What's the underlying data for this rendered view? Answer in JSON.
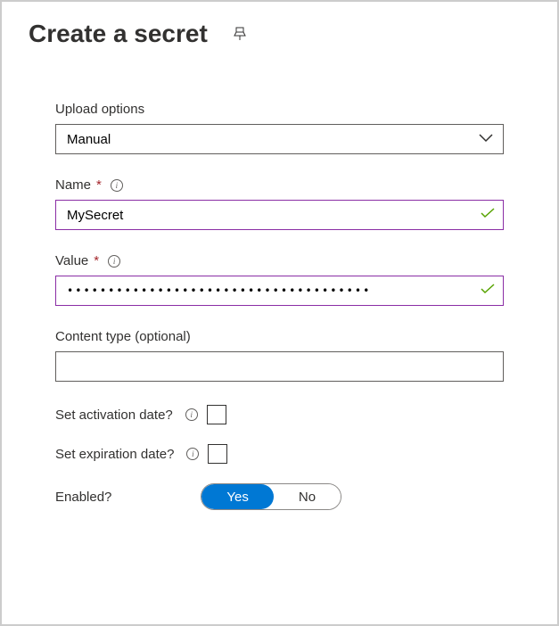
{
  "header": {
    "title": "Create a secret"
  },
  "form": {
    "upload_options": {
      "label": "Upload options",
      "value": "Manual"
    },
    "name": {
      "label": "Name",
      "value": "MySecret"
    },
    "value": {
      "label": "Value",
      "value_masked": "•••••••••••••••••••••••••••••••••••••"
    },
    "content_type": {
      "label": "Content type (optional)",
      "value": ""
    },
    "activation_date": {
      "label": "Set activation date?",
      "checked": false
    },
    "expiration_date": {
      "label": "Set expiration date?",
      "checked": false
    },
    "enabled": {
      "label": "Enabled?",
      "yes_label": "Yes",
      "no_label": "No",
      "value": "Yes"
    }
  }
}
